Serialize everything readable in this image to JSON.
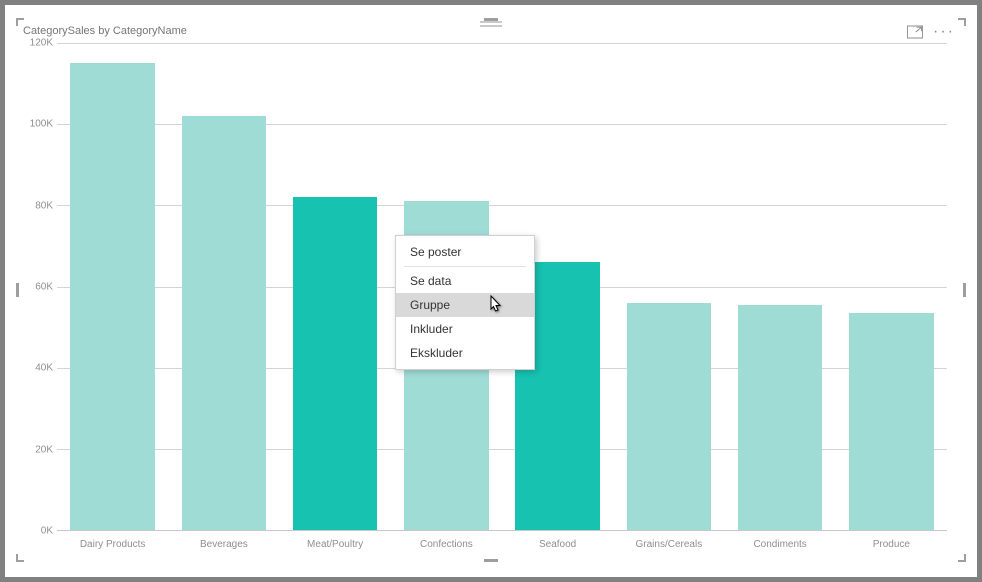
{
  "title": "CategorySales by CategoryName",
  "toolbar": {
    "focus_mode": "Focus mode",
    "more_options": "More options"
  },
  "context_menu": {
    "se_poster": "Se poster",
    "se_data": "Se data",
    "gruppe": "Gruppe",
    "inkluder": "Inkluder",
    "ekskluder": "Ekskluder"
  },
  "y_ticks": [
    "0K",
    "20K",
    "40K",
    "60K",
    "80K",
    "100K",
    "120K"
  ],
  "chart_data": {
    "type": "bar",
    "title": "CategorySales by CategoryName",
    "xlabel": "",
    "ylabel": "",
    "ylim": [
      0,
      120000
    ],
    "categories": [
      "Dairy Products",
      "Beverages",
      "Meat/Poultry",
      "Confections",
      "Seafood",
      "Grains/Cereals",
      "Condiments",
      "Produce"
    ],
    "values": [
      115000,
      102000,
      82000,
      81000,
      66000,
      56000,
      55500,
      53500
    ],
    "selected_indices": [
      2,
      4
    ],
    "colors": {
      "default": "#a0dcd6",
      "selected": "#17c2b1"
    }
  }
}
